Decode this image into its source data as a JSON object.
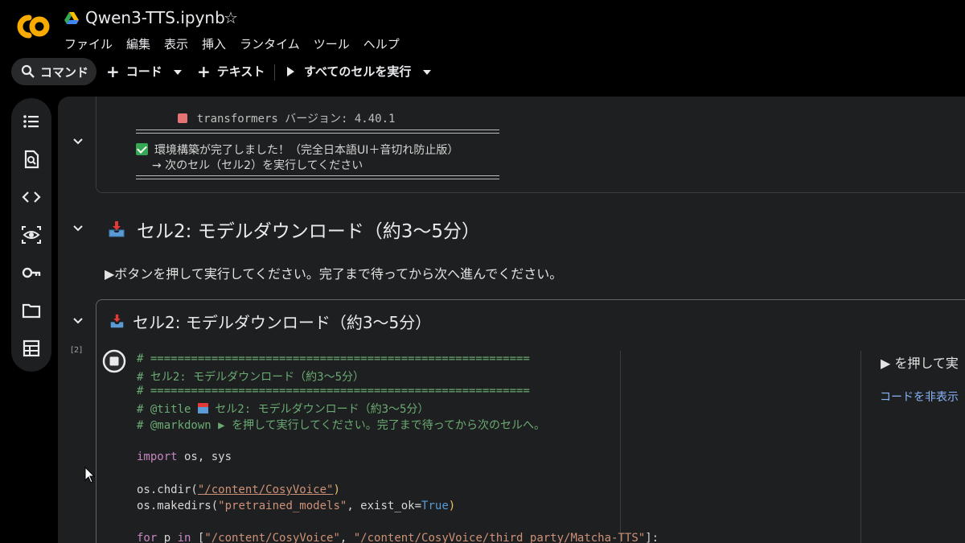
{
  "header": {
    "logo_text": "CO",
    "notebook_title": "Qwen3-TTS.ipynb",
    "star_icon": "☆",
    "menu": [
      "ファイル",
      "編集",
      "表示",
      "挿入",
      "ランタイム",
      "ツール",
      "ヘルプ"
    ]
  },
  "toolbar": {
    "command_label": "コマンド",
    "add_code_label": "コード",
    "add_text_label": "テキスト",
    "run_all_label": "すべてのセルを実行"
  },
  "rail_icons": [
    "toc-icon",
    "find-icon",
    "code-snippets-icon",
    "variables-icon",
    "secrets-key-icon",
    "files-folder-icon",
    "data-table-icon"
  ],
  "output": {
    "partial_line": "transformers バージョン: 4.40.1",
    "done_line": "環境構築が完了しました！（完全日本語UI＋音切れ防止版）",
    "next_line": "→ 次のセル（セル2）を実行してください"
  },
  "markdown": {
    "title": "セル2: モデルダウンロード（約3〜5分）",
    "body": "▶ボタンを押して実行してください。完了まで待ってから次へ進んでください。"
  },
  "code_cell": {
    "title": "セル2: モデルダウンロード（約3〜5分）",
    "exec_count": "[2]",
    "lines": {
      "c1": "# ========================================================",
      "c2": "# セル2: モデルダウンロード（約3〜5分）",
      "c3": "# ========================================================",
      "c4a": "# @title ",
      "c4b": " セル2: モデルダウンロード（約3〜5分）",
      "c5": "# @markdown ▶ を押して実行してください。完了まで待ってから次のセルへ。",
      "imp_kw": "import",
      "imp_rest": " os, sys",
      "chdir_fn": "os.chdir(",
      "chdir_path": "\"/content/CosyVoice\"",
      "close": ")",
      "mk_fn": "os.makedirs(",
      "mk_str": "\"pretrained_models\"",
      "mk_mid": ", exist_ok=",
      "mk_true": "True",
      "for_kw": "for",
      "for_p": " p ",
      "in_kw": "in",
      "for_list_a": " [",
      "for_s1": "\"/content/CosyVoice\"",
      "for_comma": ", ",
      "for_s2": "\"/content/CosyVoice/third_party/Matcha-TTS\"",
      "for_end": "]:"
    },
    "form_text": "▶ を押して実",
    "hide_code": "コードを非表示"
  },
  "colors": {
    "comment": "#6aab73",
    "keyword": "#c586c0",
    "string": "#ce9178",
    "bool": "#569cd6",
    "link": "#8ab4f8"
  }
}
